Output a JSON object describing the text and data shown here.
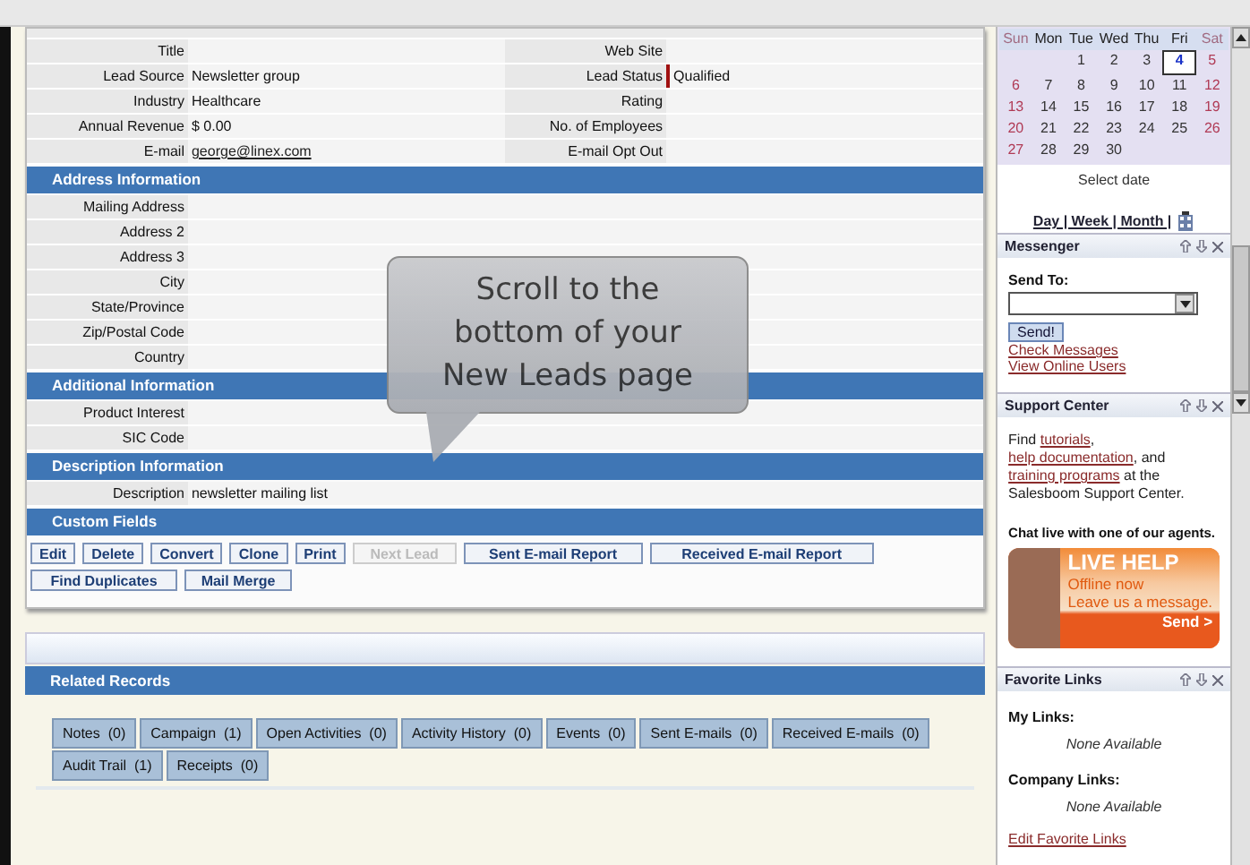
{
  "lead_sections": [
    {
      "rows": [
        {
          "cells": [
            {
              "label": "Title"
            },
            {
              "label": "Web Site"
            }
          ]
        },
        {
          "cells": [
            {
              "label": "Lead Source",
              "value": "Newsletter group"
            },
            {
              "label": "Lead Status",
              "value": "Qualified",
              "required": true
            }
          ]
        },
        {
          "cells": [
            {
              "label": "Industry",
              "value": "Healthcare"
            },
            {
              "label": "Rating"
            }
          ]
        },
        {
          "cells": [
            {
              "label": "Annual Revenue",
              "value": "$  0.00"
            },
            {
              "label": "No. of Employees"
            }
          ]
        },
        {
          "cells": [
            {
              "label": "E-mail",
              "value": "george@linex.com",
              "kind": "link"
            },
            {
              "label": "E-mail Opt Out"
            }
          ]
        }
      ]
    },
    {
      "title": "Address Information",
      "rows": [
        {
          "cells": [
            {
              "label": "Mailing Address"
            }
          ]
        },
        {
          "cells": [
            {
              "label": "Address 2"
            }
          ]
        },
        {
          "cells": [
            {
              "label": "Address 3"
            }
          ]
        },
        {
          "cells": [
            {
              "label": "City"
            }
          ]
        },
        {
          "cells": [
            {
              "label": "State/Province"
            }
          ]
        },
        {
          "cells": [
            {
              "label": "Zip/Postal Code"
            }
          ]
        },
        {
          "cells": [
            {
              "label": "Country"
            }
          ]
        }
      ]
    },
    {
      "title": "Additional Information",
      "rows": [
        {
          "cells": [
            {
              "label": "Product Interest"
            }
          ]
        },
        {
          "cells": [
            {
              "label": "SIC Code"
            }
          ]
        }
      ]
    },
    {
      "title": "Description Information",
      "rows": [
        {
          "cells": [
            {
              "label": "Description",
              "value": "newsletter mailing list"
            }
          ]
        }
      ]
    },
    {
      "title": "Custom Fields"
    }
  ],
  "buttons": [
    [
      {
        "label": "Edit",
        "disabled": false
      },
      {
        "label": "Delete",
        "disabled": false
      },
      {
        "label": "Convert",
        "disabled": false
      },
      {
        "label": "Clone",
        "disabled": false
      },
      {
        "label": "Print",
        "disabled": false
      },
      {
        "label": "Next Lead",
        "disabled": true
      },
      {
        "label": "Sent E-mail Report",
        "disabled": false
      },
      {
        "label": "Received E-mail Report",
        "disabled": false
      }
    ],
    [
      {
        "label": "Find Duplicates",
        "disabled": false
      },
      {
        "label": "Mail Merge",
        "disabled": false
      }
    ]
  ],
  "related_records": {
    "title": "Related Records",
    "tabs": [
      {
        "label": "Notes  (0)",
        "selected": false
      },
      {
        "label": "Campaign  (1)",
        "selected": false
      },
      {
        "label": "Open Activities  (0)",
        "selected": false
      },
      {
        "label": "Activity History  (0)",
        "selected": false
      },
      {
        "label": "Events  (0)",
        "selected": false
      },
      {
        "label": "Sent E-mails  (0)",
        "selected": false
      },
      {
        "label": "Received E-mails  (0)",
        "selected": false
      },
      {
        "label": "Audit Trail  (1)",
        "selected": false
      },
      {
        "label": "Receipts  (0)",
        "selected": false
      }
    ]
  },
  "callout": {
    "text": "Scroll to the bottom of your New Leads page"
  },
  "calendar": {
    "weekdays": [
      {
        "label": "Sun",
        "weekend": true
      },
      {
        "label": "Mon",
        "weekend": false
      },
      {
        "label": "Tue",
        "weekend": false
      },
      {
        "label": "Wed",
        "weekend": false
      },
      {
        "label": "Thu",
        "weekend": false
      },
      {
        "label": "Fri",
        "weekend": false
      },
      {
        "label": "Sat",
        "weekend": true
      }
    ],
    "weeks": [
      {
        "starts_mid_week": true,
        "days": [
          {
            "day": "1",
            "selected": false
          },
          {
            "day": "2",
            "selected": false
          },
          {
            "day": "3",
            "selected": false
          },
          {
            "day": "4",
            "selected": true
          },
          {
            "day": "5",
            "selected": false
          }
        ]
      },
      {
        "days": [
          {
            "day": "6",
            "selected": false
          },
          {
            "day": "7",
            "selected": false
          },
          {
            "day": "8",
            "selected": false
          },
          {
            "day": "9",
            "selected": false
          },
          {
            "day": "10",
            "selected": false
          },
          {
            "day": "11",
            "selected": false
          },
          {
            "day": "12",
            "selected": false
          }
        ]
      },
      {
        "days": [
          {
            "day": "13",
            "selected": false
          },
          {
            "day": "14",
            "selected": false
          },
          {
            "day": "15",
            "selected": false
          },
          {
            "day": "16",
            "selected": false
          },
          {
            "day": "17",
            "selected": false
          },
          {
            "day": "18",
            "selected": false
          },
          {
            "day": "19",
            "selected": false
          }
        ]
      },
      {
        "days": [
          {
            "day": "20",
            "selected": false
          },
          {
            "day": "21",
            "selected": false
          },
          {
            "day": "22",
            "selected": false
          },
          {
            "day": "23",
            "selected": false
          },
          {
            "day": "24",
            "selected": false
          },
          {
            "day": "25",
            "selected": false
          },
          {
            "day": "26",
            "selected": false
          }
        ]
      },
      {
        "days": [
          {
            "day": "27",
            "selected": false
          },
          {
            "day": "28",
            "selected": false
          },
          {
            "day": "29",
            "selected": false
          },
          {
            "day": "30",
            "selected": false
          }
        ]
      }
    ],
    "caption": "Select date",
    "views": "Day | Week | Month |"
  },
  "messenger": {
    "title": "Messenger",
    "send_to_label": "Send To:",
    "send_button": "Send!",
    "links": [
      "Check Messages",
      "View Online Users"
    ]
  },
  "support_center": {
    "title": "Support Center",
    "text": [
      {
        "text": "Find "
      },
      {
        "text": "tutorials",
        "kind": "link"
      },
      {
        "text": ", "
      },
      {
        "text": "help documentation",
        "kind": "link"
      },
      {
        "text": ", and "
      },
      {
        "text": "training programs",
        "kind": "link"
      },
      {
        "text": " at the Salesboom Support Center."
      }
    ],
    "chat_text": "Chat live with one of our agents.",
    "banner": {
      "title": "LIVE HELP",
      "status": "Offline now",
      "message": "Leave us a message.",
      "send": "Send >"
    }
  },
  "favorite_links": {
    "title": "Favorite Links",
    "groups": [
      {
        "title": "My Links:",
        "empty": "None Available"
      },
      {
        "title": "Company Links:",
        "empty": "None Available"
      }
    ],
    "edit_link": "Edit Favorite Links"
  }
}
